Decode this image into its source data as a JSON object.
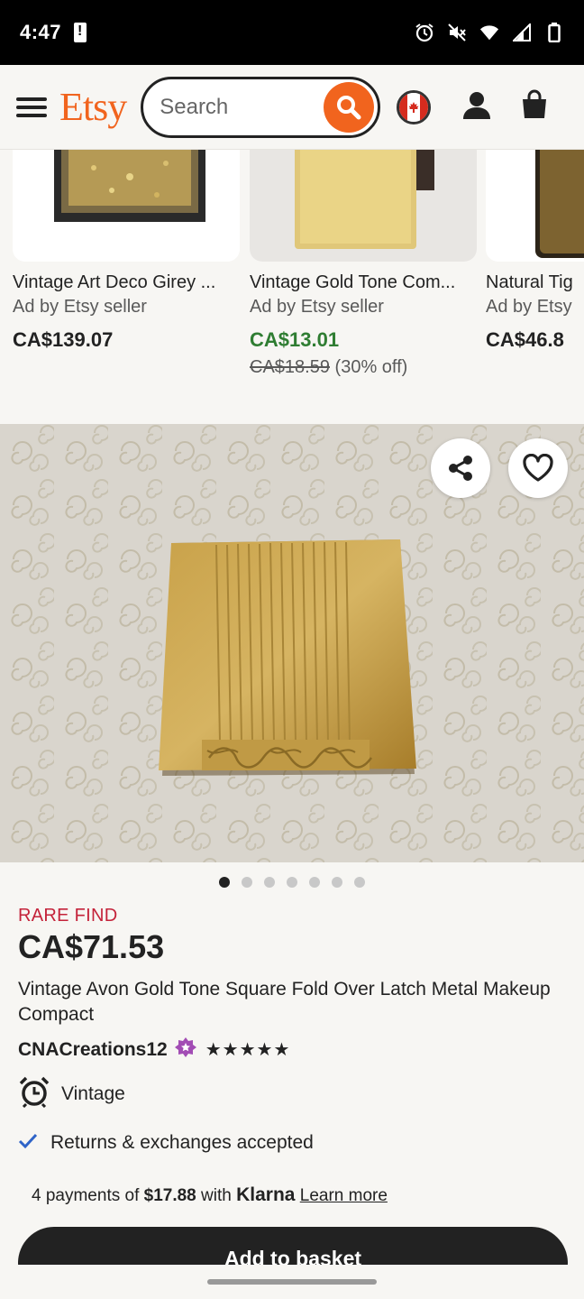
{
  "status_bar": {
    "time": "4:47"
  },
  "header": {
    "logo": "Etsy",
    "search_placeholder": "Search",
    "brand_color": "#f1641e"
  },
  "recommended": [
    {
      "title": "Vintage Art Deco Girey ...",
      "subtitle": "Ad by Etsy seller",
      "price": "CA$139.07"
    },
    {
      "title": "Vintage Gold Tone Com...",
      "subtitle": "Ad by Etsy seller",
      "price": "CA$13.01",
      "original_price": "CA$18.59",
      "discount": "(30% off)"
    },
    {
      "title": "Natural Tig",
      "subtitle": "Ad by Etsy",
      "price": "CA$46.8"
    }
  ],
  "gallery": {
    "total_images": 7,
    "active_index": 0
  },
  "product": {
    "badge": "RARE FIND",
    "price": "CA$71.53",
    "title": "Vintage Avon Gold Tone Square Fold Over Latch Metal Makeup Compact",
    "shop_name": "CNACreations12",
    "rating": 5,
    "stars": "★★★★★",
    "vintage_label": "Vintage",
    "returns_label": "Returns & exchanges accepted",
    "klarna": {
      "prefix": "4 payments of",
      "amount": "$17.88",
      "mid": "with",
      "brand": "Klarna",
      "link": "Learn more"
    },
    "add_to_basket": "Add to basket"
  }
}
